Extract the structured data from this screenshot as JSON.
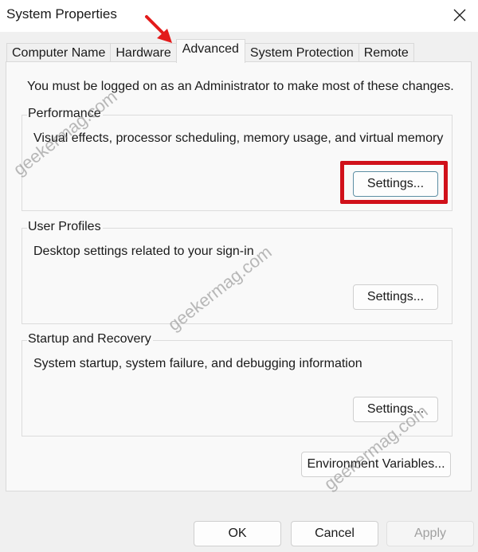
{
  "window": {
    "title": "System Properties",
    "close_icon": "close-icon"
  },
  "tabs": [
    {
      "label": "Computer Name",
      "active": false
    },
    {
      "label": "Hardware",
      "active": false
    },
    {
      "label": "Advanced",
      "active": true
    },
    {
      "label": "System Protection",
      "active": false
    },
    {
      "label": "Remote",
      "active": false
    }
  ],
  "advanced": {
    "admin_note": "You must be logged on as an Administrator to make most of these changes.",
    "groups": [
      {
        "label": "Performance",
        "description": "Visual effects, processor scheduling, memory usage, and virtual memory",
        "button_label": "Settings..."
      },
      {
        "label": "User Profiles",
        "description": "Desktop settings related to your sign-in",
        "button_label": "Settings..."
      },
      {
        "label": "Startup and Recovery",
        "description": "System startup, system failure, and debugging information",
        "button_label": "Settings..."
      }
    ],
    "environment_variables_label": "Environment Variables..."
  },
  "footer": {
    "ok_label": "OK",
    "cancel_label": "Cancel",
    "apply_label": "Apply"
  },
  "annotations": {
    "highlight_color": "#d0101a",
    "arrow_color": "#e31b1b",
    "watermark_text": "geekermag.com"
  }
}
